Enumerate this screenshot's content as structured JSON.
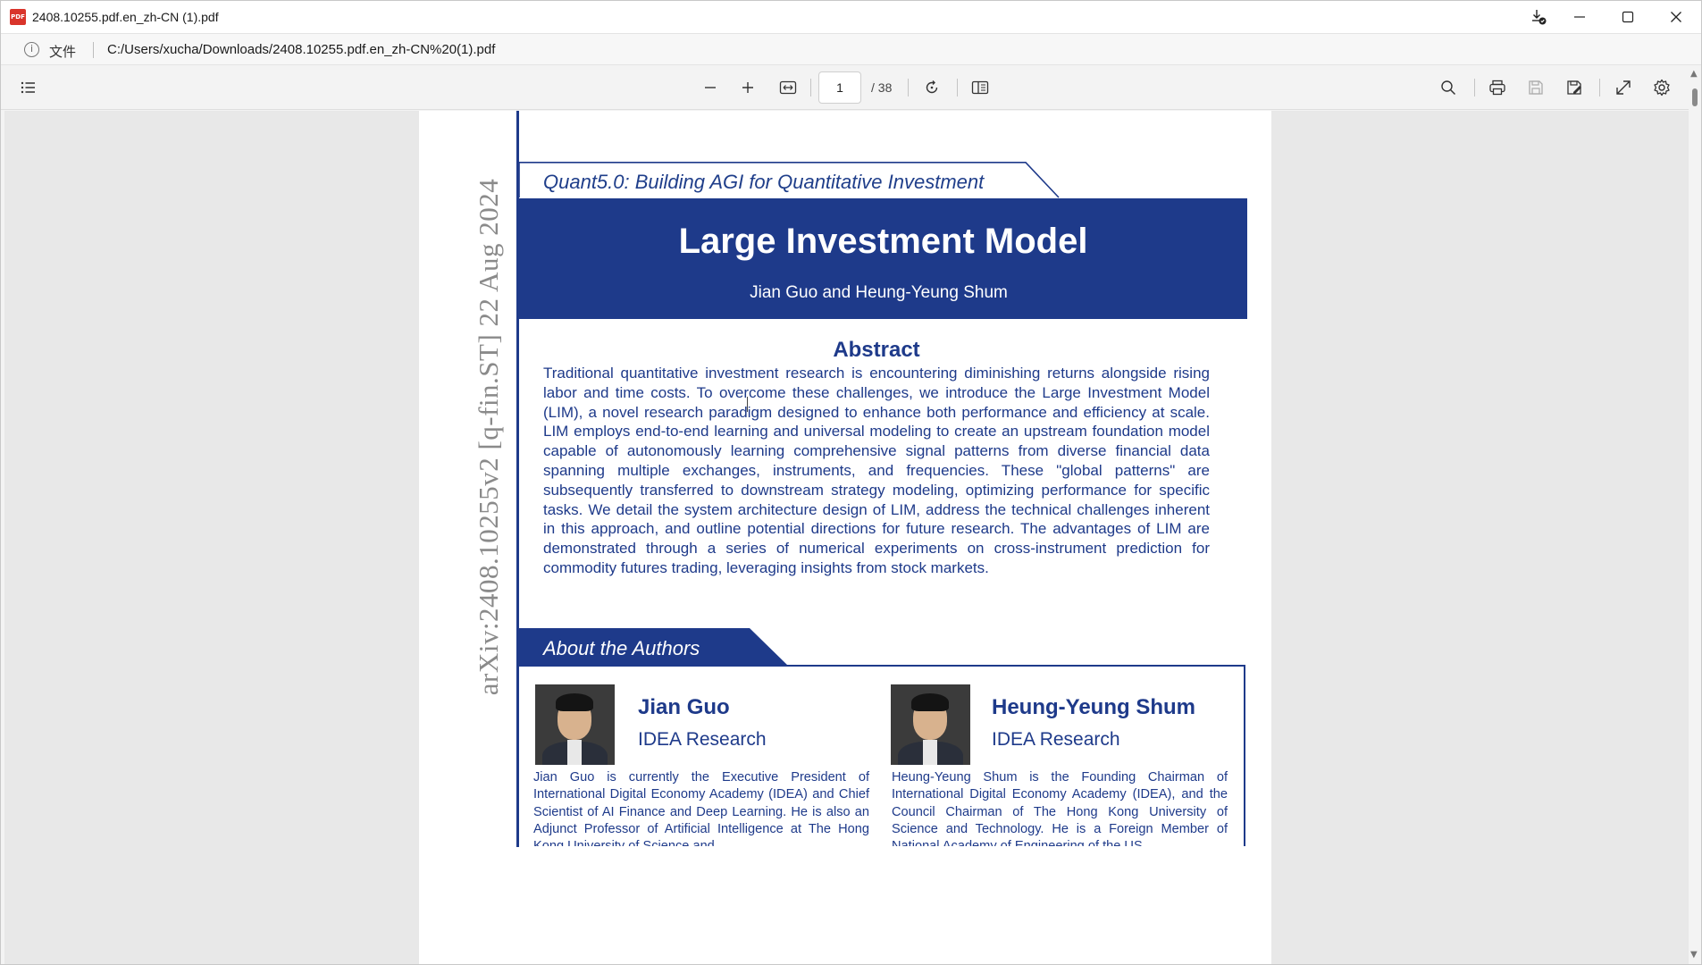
{
  "window": {
    "title": "2408.10255.pdf.en_zh-CN (1).pdf",
    "app_icon_text": "PDF"
  },
  "addressbar": {
    "file_label": "文件",
    "url": "C:/Users/xucha/Downloads/2408.10255.pdf.en_zh-CN%20(1).pdf"
  },
  "toolbar": {
    "current_page": "1",
    "page_total": "/ 38"
  },
  "document": {
    "arxiv_id": "arXiv:2408.10255v2  [q-fin.ST]  22 Aug 2024",
    "tagline": "Quant5.0: Building AGI for Quantitative Investment",
    "title": "Large Investment Model",
    "authors": "Jian Guo and Heung-Yeung Shum",
    "abstract_heading": "Abstract",
    "abstract_text": "Traditional quantitative investment research is encountering diminishing returns alongside rising labor and time costs. To overcome these challenges, we introduce the Large Investment Model (LIM), a novel research paradigm designed to enhance both performance and efficiency at scale. LIM employs end-to-end learning and universal modeling to create an upstream foundation model capable of autonomously learning comprehensive signal patterns from diverse financial data spanning multiple exchanges, instruments, and frequencies. These \"global patterns\" are subsequently transferred to downstream strategy modeling, optimizing performance for specific tasks. We detail the system architecture design of LIM, address the technical challenges inherent in this approach, and outline potential directions for future research. The advantages of LIM are demonstrated through a series of numerical experiments on cross-instrument prediction for commodity futures trading, leveraging insights from stock markets.",
    "about_heading": "About the Authors",
    "author1": {
      "name": "Jian Guo",
      "org": "IDEA Research",
      "bio": "Jian Guo is currently the Executive President of International Digital Economy Academy (IDEA) and Chief Scientist of AI Finance and Deep Learning. He is also an Adjunct Professor of Artificial Intelligence at The Hong Kong University of Science and"
    },
    "author2": {
      "name": "Heung-Yeung Shum",
      "org": "IDEA Research",
      "bio": "Heung-Yeung Shum is the Founding Chairman of International Digital Economy Academy (IDEA), and the Council Chairman of The Hong Kong University of Science and Technology. He is a Foreign Member of National Academy of Engineering of the US"
    }
  },
  "colors": {
    "accent_blue": "#1e3a8a",
    "viewer_bg": "#e8e8e8"
  },
  "icons": [
    "pdf-app-icon",
    "download-done-icon",
    "minimize-icon",
    "maximize-icon",
    "close-icon",
    "info-icon",
    "outline-list-icon",
    "zoom-out-icon",
    "zoom-in-icon",
    "fit-width-icon",
    "rotate-icon",
    "page-view-icon",
    "search-icon",
    "print-icon",
    "save-icon",
    "save-as-icon",
    "fullscreen-icon",
    "settings-icon"
  ]
}
